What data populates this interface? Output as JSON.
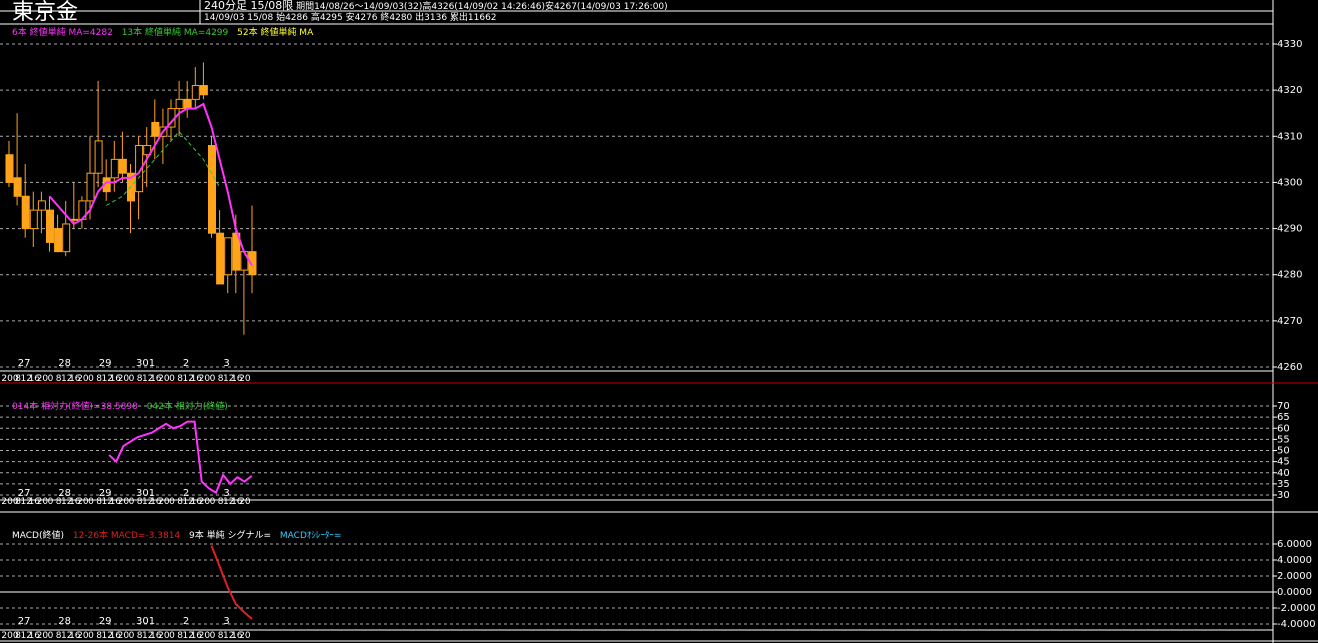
{
  "app": {
    "title": "東京金",
    "header_line1": "240分足 15/08限",
    "header_period": "期間14/08/26～14/09/03(32)高4326(14/09/02 14:26:46)安4267(14/09/03 17:26:00)",
    "header_line2": "14/09/03 15/08 始4286 高4295 安4276 終4280 出3136 累出11662"
  },
  "colors": {
    "up": "#ffa31a",
    "down": "#ffa31a",
    "ma6": "#ff33ff",
    "ma13": "#33cc33",
    "ma52": "#ffff33",
    "rsi14": "#ff33ff",
    "rsi42": "#33cc33",
    "macd": "#dd2222",
    "signal": "#33ccff",
    "grid": "#aaaaaa",
    "axis": "#ffffff",
    "sep": "#cc0000"
  },
  "legends": {
    "price": [
      {
        "text": "6本 終値単純 MA=4282",
        "color": "#ff33ff"
      },
      {
        "text": "13本 終値単純 MA=4299",
        "color": "#33cc33"
      },
      {
        "text": "52本 終値単純 MA",
        "color": "#ffff33"
      }
    ],
    "rsi": [
      {
        "text": "014本 相対力(終値)=38.5898",
        "color": "#ff33ff"
      },
      {
        "text": "042本 相対力(終値)",
        "color": "#33cc33"
      }
    ],
    "macd": [
      {
        "text": "MACD(終値)",
        "color": "#ffffff"
      },
      {
        "text": "12-26本 MACD=-3.3814",
        "color": "#dd2222"
      },
      {
        "text": "9本 単純 シグナル=",
        "color": "#ffffff"
      },
      {
        "text": "MACDｵｼﾚｰﾀｰ=",
        "color": "#33ccff"
      }
    ]
  },
  "chart_data": [
    {
      "type": "candlestick",
      "ylim": [
        4260,
        4330
      ],
      "yticks": [
        4260,
        4270,
        4280,
        4290,
        4300,
        4310,
        4320,
        4330
      ],
      "day_labels": [
        "27",
        "28",
        "29",
        "301",
        "2",
        "3"
      ],
      "time_labels": [
        "200",
        "8",
        "12",
        "16",
        "20",
        "0",
        "8",
        "12",
        "16",
        "20",
        "0",
        "8",
        "12",
        "16",
        "20",
        "0",
        "8",
        "12",
        "16",
        "20",
        "0",
        "8",
        "12",
        "16",
        "20",
        "0",
        "8",
        "12",
        "16",
        "20"
      ],
      "candles": [
        [
          4306,
          4309,
          4299,
          4300
        ],
        [
          4301,
          4315,
          4295,
          4297
        ],
        [
          4297,
          4304,
          4288,
          4290
        ],
        [
          4290,
          4298,
          4286,
          4294
        ],
        [
          4294,
          4298,
          4289,
          4296
        ],
        [
          4294,
          4297,
          4285,
          4287
        ],
        [
          4290,
          4293,
          4285,
          4285
        ],
        [
          4285,
          4296,
          4284,
          4291
        ],
        [
          4292,
          4300,
          4290,
          4292
        ],
        [
          4292,
          4297,
          4290,
          4296
        ],
        [
          4296,
          4310,
          4292,
          4302
        ],
        [
          4302,
          4322,
          4299,
          4309
        ],
        [
          4301,
          4305,
          4296,
          4298
        ],
        [
          4301,
          4309,
          4298,
          4305
        ],
        [
          4305,
          4311,
          4300,
          4302
        ],
        [
          4302,
          4304,
          4289,
          4296
        ],
        [
          4298,
          4310,
          4292,
          4308
        ],
        [
          4306,
          4312,
          4299,
          4308
        ],
        [
          4313,
          4318,
          4305,
          4310
        ],
        [
          4310,
          4316,
          4304,
          4312
        ],
        [
          4312,
          4318,
          4309,
          4316
        ],
        [
          4316,
          4322,
          4310,
          4318
        ],
        [
          4318,
          4322,
          4314,
          4316
        ],
        [
          4318,
          4325,
          4316,
          4321
        ],
        [
          4321,
          4326,
          4318,
          4319
        ],
        [
          4308,
          4310,
          4288,
          4289
        ],
        [
          4289,
          4294,
          4278,
          4278
        ],
        [
          4280,
          4288,
          4276,
          4288
        ],
        [
          4289,
          4293,
          4276,
          4281
        ],
        [
          4281,
          4284,
          4267,
          4285
        ],
        [
          4285,
          4295,
          4276,
          4280
        ]
      ],
      "ma6": [
        null,
        null,
        null,
        null,
        null,
        4297,
        4295,
        4293,
        4291,
        4292,
        4294,
        4298,
        4300,
        4300,
        4301,
        4301,
        4302,
        4305,
        4308,
        4311,
        4313,
        4315,
        4316,
        4316,
        4317,
        4312,
        4305,
        4298,
        4290,
        4285,
        4282
      ],
      "ma13": [
        null,
        null,
        null,
        null,
        null,
        null,
        null,
        null,
        null,
        null,
        null,
        null,
        4295,
        4296,
        4297,
        4299,
        4301,
        4303,
        4305,
        4307,
        4309,
        4311,
        4309,
        4307,
        4305,
        4302,
        4299
      ]
    },
    {
      "type": "line",
      "ylim": [
        30,
        70
      ],
      "yticks": [
        30,
        35,
        40,
        45,
        50,
        55,
        60,
        65,
        70
      ],
      "day_labels": [
        "27",
        "28",
        "29",
        "301",
        "2",
        "3"
      ],
      "time_labels": [
        "200",
        "8",
        "12",
        "16",
        "20",
        "0",
        "8",
        "12",
        "16",
        "20",
        "0",
        "8",
        "12",
        "16",
        "20",
        "0",
        "8",
        "12",
        "16",
        "20",
        "0",
        "8",
        "12",
        "16",
        "20",
        "0",
        "8",
        "12",
        "16",
        "20"
      ],
      "series": [
        {
          "name": "014本 相対力(終値)",
          "values": [
            null,
            null,
            null,
            null,
            null,
            null,
            null,
            null,
            null,
            null,
            null,
            null,
            null,
            null,
            48,
            45,
            52,
            54,
            56,
            57,
            58,
            60,
            62,
            60,
            61,
            63,
            63,
            36,
            33,
            31,
            39,
            35,
            38,
            36,
            38.5898
          ]
        }
      ]
    },
    {
      "type": "line",
      "ylim": [
        -4,
        6
      ],
      "yticks": [
        -4,
        -2,
        0,
        2,
        4,
        6
      ],
      "ytick_labels": [
        "-4.0000",
        "-2.0000",
        "0.0000",
        "2.0000",
        "4.0000",
        "6.0000"
      ],
      "day_labels": [
        "27",
        "28",
        "29",
        "301",
        "2",
        "3"
      ],
      "time_labels": [
        "200",
        "8",
        "12",
        "16",
        "20",
        "0",
        "8",
        "12",
        "16",
        "20",
        "0",
        "8",
        "12",
        "16",
        "20",
        "0",
        "8",
        "12",
        "16",
        "20",
        "0",
        "8",
        "12",
        "16",
        "20",
        "0",
        "8",
        "12",
        "16",
        "20"
      ],
      "series": [
        {
          "name": "12-26本 MACD",
          "values": [
            null,
            null,
            null,
            null,
            null,
            null,
            null,
            null,
            null,
            null,
            null,
            null,
            null,
            null,
            null,
            null,
            null,
            null,
            null,
            null,
            null,
            null,
            null,
            null,
            null,
            5.8,
            3.2,
            0.6,
            -1.5,
            -2.5,
            -3.3814
          ]
        }
      ]
    }
  ]
}
